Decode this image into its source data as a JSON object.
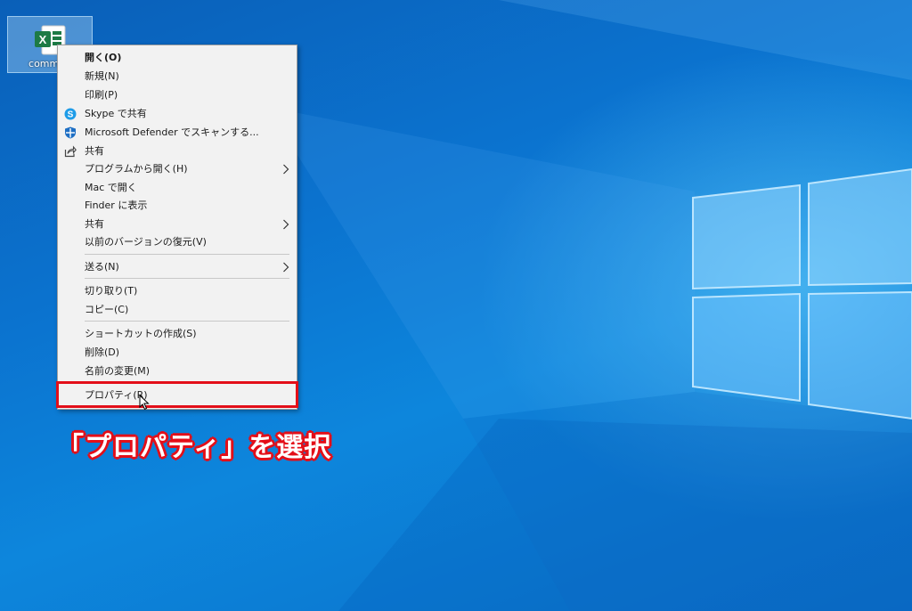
{
  "desktop": {
    "icon_label": "comman",
    "icon_name": "excel-icon"
  },
  "context_menu": {
    "items": [
      {
        "label": "開く(O)",
        "bold": true
      },
      {
        "label": "新規(N)"
      },
      {
        "label": "印刷(P)"
      },
      {
        "label": "Skype で共有",
        "icon": "skype-icon"
      },
      {
        "label": "Microsoft Defender でスキャンする...",
        "icon": "defender-icon"
      },
      {
        "label": "共有",
        "icon": "share-icon"
      },
      {
        "label": "プログラムから開く(H)",
        "submenu": true
      },
      {
        "label": "Mac で開く"
      },
      {
        "label": "Finder に表示"
      },
      {
        "label": "共有",
        "submenu": true
      },
      {
        "label": "以前のバージョンの復元(V)"
      },
      {
        "label": "送る(N)",
        "submenu": true
      },
      {
        "label": "切り取り(T)"
      },
      {
        "label": "コピー(C)"
      },
      {
        "label": "ショートカットの作成(S)"
      },
      {
        "label": "削除(D)"
      },
      {
        "label": "名前の変更(M)"
      },
      {
        "label": "プロパティ(R)",
        "highlighted": true
      }
    ]
  },
  "annotation": {
    "text": "「プロパティ」を選択",
    "color": "#e30f19"
  },
  "colors": {
    "desktop_blue": "#0b73cf",
    "menu_bg": "#f2f2f2",
    "highlight_red": "#e30f19"
  }
}
